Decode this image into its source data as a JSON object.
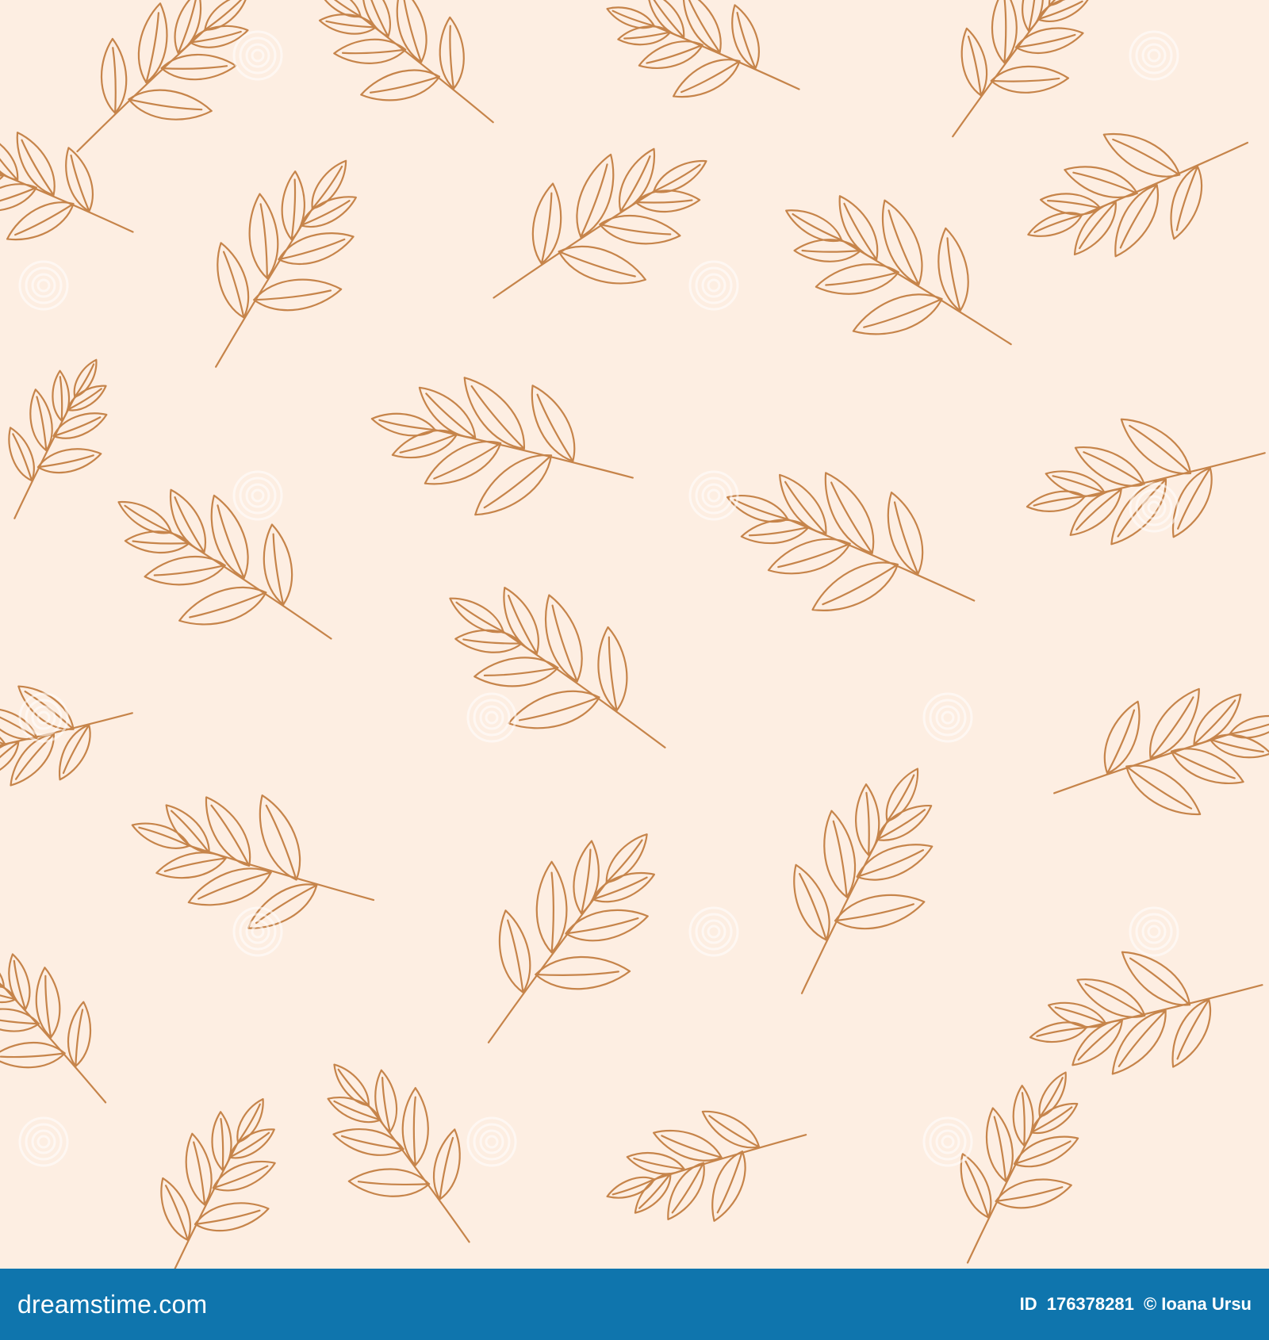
{
  "pattern": {
    "background_color": "#fdeee2",
    "line_color": "#c6844a",
    "motif": "leaf-branch-outline",
    "watermark_motif": "spiral-watermark"
  },
  "footer": {
    "background_color": "#0f75ad",
    "logo_text": "dreamstime.com",
    "id_label": "ID",
    "id_value": "176378281",
    "author": "© Ioana Ursu"
  }
}
